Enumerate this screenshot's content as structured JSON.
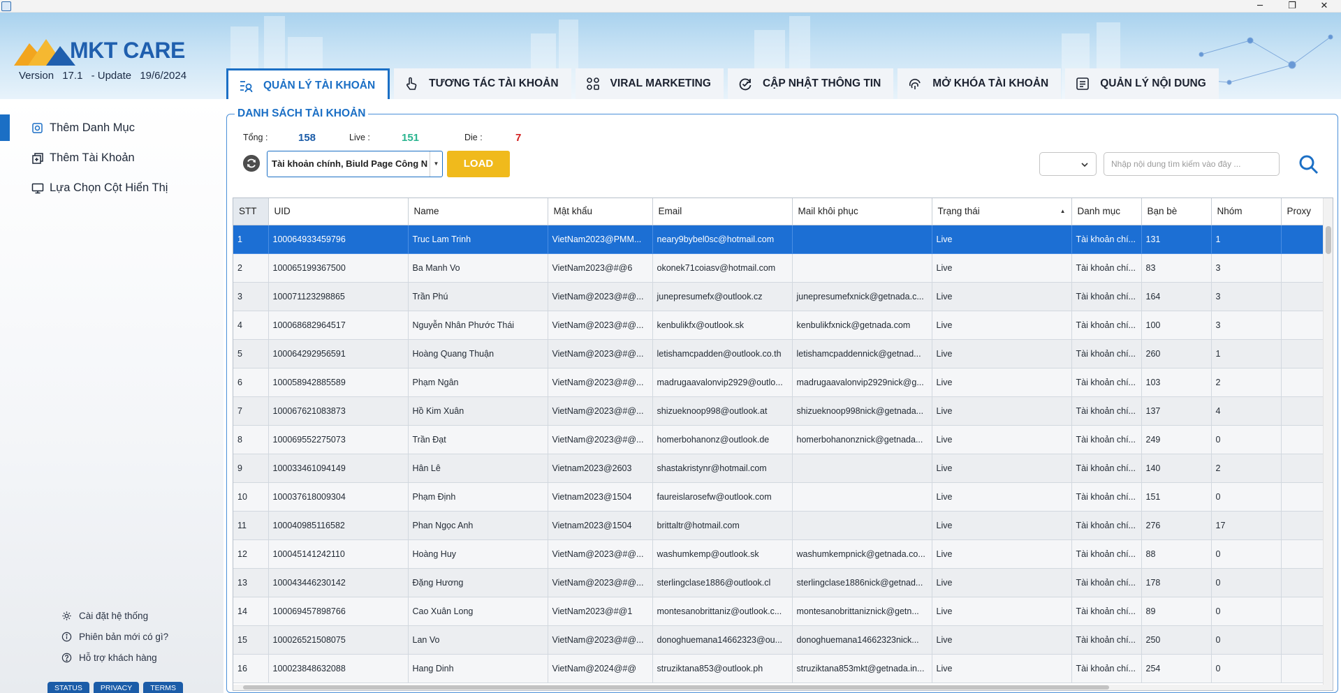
{
  "app": {
    "brand": "MKT CARE",
    "version_label": "Version",
    "version": "17.1",
    "update_label": "- Update",
    "update_date": "19/6/2024"
  },
  "window_controls": {
    "minimize": "─",
    "maximize": "❐",
    "close": "✕"
  },
  "tabs": [
    {
      "label": "QUẢN LÝ TÀI KHOẢN",
      "icon": "account-list-icon",
      "active": true
    },
    {
      "label": "TƯƠNG TÁC TÀI KHOẢN",
      "icon": "hand-pointer-icon",
      "active": false
    },
    {
      "label": "VIRAL MARKETING",
      "icon": "apps-grid-icon",
      "active": false
    },
    {
      "label": "CẬP NHẬT THÔNG TIN",
      "icon": "refresh-check-icon",
      "active": false
    },
    {
      "label": "MỞ KHÓA TÀI KHOẢN",
      "icon": "fingerprint-icon",
      "active": false
    },
    {
      "label": "QUẢN LÝ NỘI DUNG",
      "icon": "document-icon",
      "active": false
    }
  ],
  "sidebar": {
    "items": [
      {
        "label": "Thêm Danh Mục",
        "icon": "add-folder-icon"
      },
      {
        "label": "Thêm Tài Khoản",
        "icon": "add-account-icon"
      },
      {
        "label": "Lựa Chọn Cột Hiển Thị",
        "icon": "monitor-icon"
      }
    ],
    "footer_items": [
      {
        "label": "Cài đặt hệ thống",
        "icon": "gear-icon"
      },
      {
        "label": "Phiên bản mới có gì?",
        "icon": "info-icon"
      },
      {
        "label": "Hỗ trợ khách hàng",
        "icon": "help-icon"
      }
    ],
    "footer_links": [
      "STATUS",
      "PRIVACY",
      "TERMS"
    ]
  },
  "panel": {
    "title": "DANH SÁCH TÀI KHOẢN",
    "total_label": "Tổng :",
    "total": "158",
    "live_label": "Live :",
    "live": "151",
    "die_label": "Die :",
    "die": "7",
    "category_select": "Tài khoản chính, Biuld Page Công N",
    "load_label": "LOAD",
    "search_placeholder": "Nhập nội dung tìm kiếm vào đây ...",
    "colors": {
      "accent": "#1b6fc5",
      "load": "#f0ba1c",
      "total": "#1b5ca8",
      "live": "#29b48f",
      "die": "#d21e1e"
    }
  },
  "table": {
    "columns": [
      "STT",
      "UID",
      "Name",
      "Mật khẩu",
      "Email",
      "Mail khôi phục",
      "Trạng thái",
      "Danh mục",
      "Bạn bè",
      "Nhóm",
      "Proxy"
    ],
    "rows": [
      [
        "1",
        "100064933459796",
        "Truc Lam Trinh",
        "VietNam2023@PMM...",
        "neary9bybel0sc@hotmail.com",
        "",
        "Live",
        "Tài khoản chí...",
        "131",
        "1",
        ""
      ],
      [
        "2",
        "100065199367500",
        "Ba Manh Vo",
        "VietNam2023@#@6",
        "okonek71coiasv@hotmail.com",
        "",
        "Live",
        "Tài khoản chí...",
        "83",
        "3",
        ""
      ],
      [
        "3",
        "100071123298865",
        "Trần Phú",
        "VietNam@2023@#@...",
        "junepresumefx@outlook.cz",
        "junepresumefxnick@getnada.c...",
        "Live",
        "Tài khoản chí...",
        "164",
        "3",
        ""
      ],
      [
        "4",
        "100068682964517",
        "Nguyễn Nhân Phước Thái",
        "VietNam@2023@#@...",
        "kenbulikfx@outlook.sk",
        "kenbulikfxnick@getnada.com",
        "Live",
        "Tài khoản chí...",
        "100",
        "3",
        ""
      ],
      [
        "5",
        "100064292956591",
        "Hoàng Quang Thuận",
        "VietNam@2023@#@...",
        "letishamcpadden@outlook.co.th",
        "letishamcpaddennick@getnad...",
        "Live",
        "Tài khoản chí...",
        "260",
        "1",
        ""
      ],
      [
        "6",
        "100058942885589",
        "Phạm Ngân",
        "VietNam@2023@#@...",
        "madrugaavalonvip2929@outlo...",
        "madrugaavalonvip2929nick@g...",
        "Live",
        "Tài khoản chí...",
        "103",
        "2",
        ""
      ],
      [
        "7",
        "100067621083873",
        "Hồ Kim Xuân",
        "VietNam@2023@#@...",
        "shizueknoop998@outlook.at",
        "shizueknoop998nick@getnada...",
        "Live",
        "Tài khoản chí...",
        "137",
        "4",
        ""
      ],
      [
        "8",
        "100069552275073",
        "Trần Đạt",
        "VietNam@2023@#@...",
        "homerbohanonz@outlook.de",
        "homerbohanonznick@getnada...",
        "Live",
        "Tài khoản chí...",
        "249",
        "0",
        ""
      ],
      [
        "9",
        "100033461094149",
        "Hân Lê",
        "Vietnam2023@2603",
        "shastakristynr@hotmail.com",
        "",
        "Live",
        "Tài khoản chí...",
        "140",
        "2",
        ""
      ],
      [
        "10",
        "100037618009304",
        "Phạm Định",
        "Vietnam2023@1504",
        "faureislarosefw@outlook.com",
        "",
        "Live",
        "Tài khoản chí...",
        "151",
        "0",
        ""
      ],
      [
        "11",
        "100040985116582",
        "Phan Ngọc Anh",
        "Vietnam2023@1504",
        "brittaltr@hotmail.com",
        "",
        "Live",
        "Tài khoản chí...",
        "276",
        "17",
        ""
      ],
      [
        "12",
        "100045141242110",
        "Hoàng Huy",
        "VietNam@2023@#@...",
        "washumkemp@outlook.sk",
        "washumkempnick@getnada.co...",
        "Live",
        "Tài khoản chí...",
        "88",
        "0",
        ""
      ],
      [
        "13",
        "100043446230142",
        "Đặng Hương",
        "VietNam@2023@#@...",
        "sterlingclase1886@outlook.cl",
        "sterlingclase1886nick@getnad...",
        "Live",
        "Tài khoản chí...",
        "178",
        "0",
        ""
      ],
      [
        "14",
        "100069457898766",
        "Cao Xuân Long",
        "VietNam2023@#@1",
        "montesanobrittaniz@outlook.c...",
        "montesanobrittaniznick@getn...",
        "Live",
        "Tài khoản chí...",
        "89",
        "0",
        ""
      ],
      [
        "15",
        "100026521508075",
        "Lan Vo",
        "VietNam@2023@#@...",
        "donoghuemana14662323@ou...",
        "donoghuemana14662323nick...",
        "Live",
        "Tài khoản chí...",
        "250",
        "0",
        ""
      ],
      [
        "16",
        "100023848632088",
        "Hang Dinh",
        "VietNam@2024@#@",
        "struziktana853@outlook.ph",
        "struziktana853mkt@getnada.in...",
        "Live",
        "Tài khoản chí...",
        "254",
        "0",
        ""
      ]
    ]
  }
}
